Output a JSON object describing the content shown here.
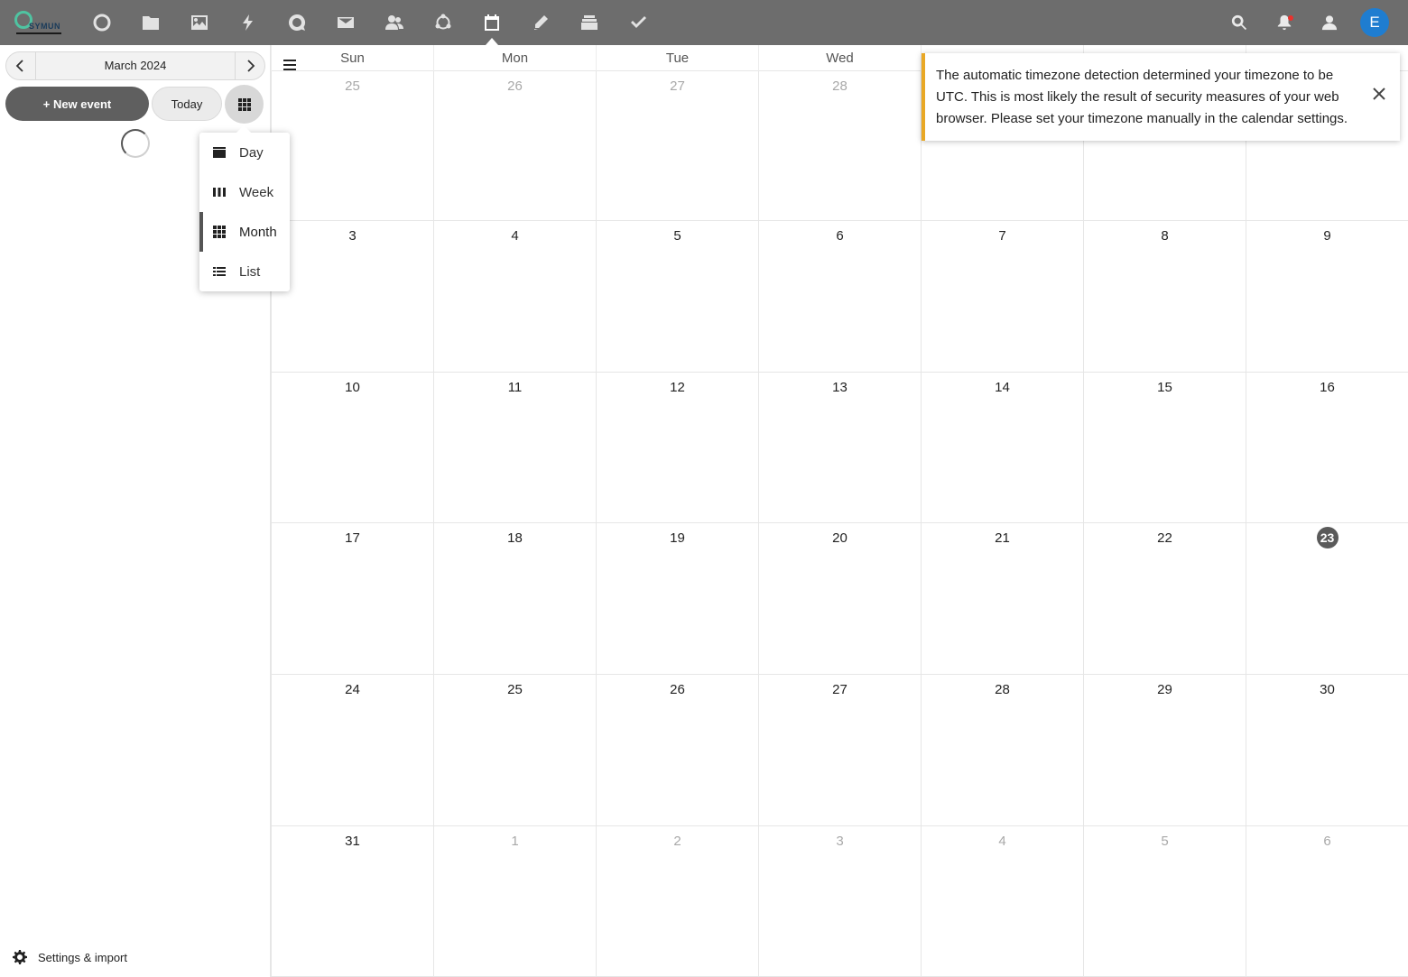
{
  "header": {
    "logo_text": "SYMUN",
    "apps": [
      {
        "name": "dashboard-icon"
      },
      {
        "name": "files-icon"
      },
      {
        "name": "photos-icon"
      },
      {
        "name": "activity-icon"
      },
      {
        "name": "talk-icon"
      },
      {
        "name": "mail-icon"
      },
      {
        "name": "contacts-icon"
      },
      {
        "name": "circles-icon"
      },
      {
        "name": "calendar-icon",
        "active": true
      },
      {
        "name": "notes-icon"
      },
      {
        "name": "deck-icon"
      },
      {
        "name": "tasks-icon"
      }
    ],
    "avatar_letter": "E"
  },
  "sidebar": {
    "month_label": "March 2024",
    "new_event_label": "+ New event",
    "today_label": "Today",
    "settings_label": "Settings & import"
  },
  "view_menu": {
    "items": [
      {
        "label": "Day",
        "icon": "day-view-icon"
      },
      {
        "label": "Week",
        "icon": "week-view-icon"
      },
      {
        "label": "Month",
        "icon": "month-view-icon",
        "active": true
      },
      {
        "label": "List",
        "icon": "list-view-icon"
      }
    ]
  },
  "calendar": {
    "weekdays": [
      "Sun",
      "Mon",
      "Tue",
      "Wed",
      "",
      "",
      ""
    ],
    "weeks": [
      [
        {
          "d": "25",
          "other": true
        },
        {
          "d": "26",
          "other": true
        },
        {
          "d": "27",
          "other": true
        },
        {
          "d": "28",
          "other": true
        },
        {
          "d": "",
          "other": true
        },
        {
          "d": "",
          "other": true
        },
        {
          "d": "",
          "other": true
        }
      ],
      [
        {
          "d": "3"
        },
        {
          "d": "4"
        },
        {
          "d": "5"
        },
        {
          "d": "6"
        },
        {
          "d": "7"
        },
        {
          "d": "8"
        },
        {
          "d": "9"
        }
      ],
      [
        {
          "d": "10"
        },
        {
          "d": "11"
        },
        {
          "d": "12"
        },
        {
          "d": "13"
        },
        {
          "d": "14"
        },
        {
          "d": "15"
        },
        {
          "d": "16"
        }
      ],
      [
        {
          "d": "17"
        },
        {
          "d": "18"
        },
        {
          "d": "19"
        },
        {
          "d": "20"
        },
        {
          "d": "21"
        },
        {
          "d": "22"
        },
        {
          "d": "23",
          "today": true
        }
      ],
      [
        {
          "d": "24"
        },
        {
          "d": "25"
        },
        {
          "d": "26"
        },
        {
          "d": "27"
        },
        {
          "d": "28"
        },
        {
          "d": "29"
        },
        {
          "d": "30"
        }
      ],
      [
        {
          "d": "31"
        },
        {
          "d": "1",
          "other": true
        },
        {
          "d": "2",
          "other": true
        },
        {
          "d": "3",
          "other": true
        },
        {
          "d": "4",
          "other": true
        },
        {
          "d": "5",
          "other": true
        },
        {
          "d": "6",
          "other": true
        }
      ]
    ]
  },
  "toast": {
    "message": "The automatic timezone detection determined your timezone to be UTC. This is most likely the result of security measures of your web browser. Please set your timezone manually in the calendar settings.",
    "accent": "#e9a825"
  }
}
